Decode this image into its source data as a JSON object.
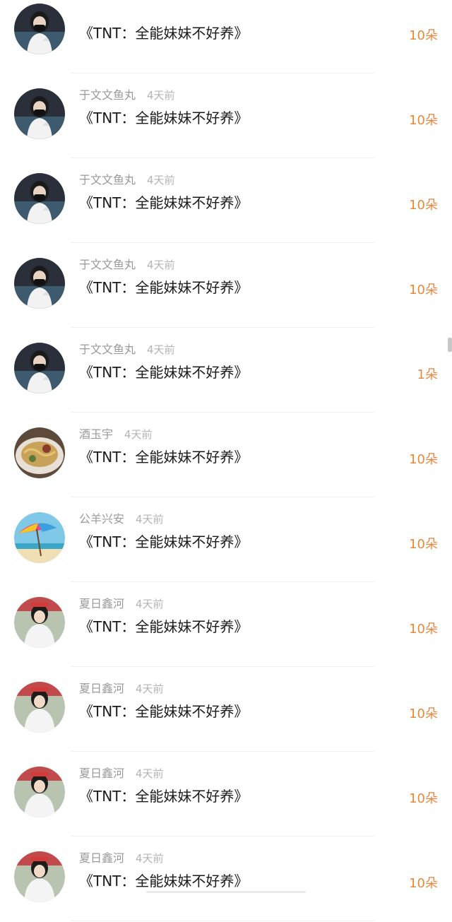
{
  "items": [
    {
      "username": "",
      "time": "",
      "title": "《TNT：全能妹妹不好养》",
      "amount": "10朵",
      "avatar": "girl-mask-icon"
    },
    {
      "username": "于文文鱼丸",
      "time": "4天前",
      "title": "《TNT：全能妹妹不好养》",
      "amount": "10朵",
      "avatar": "girl-mask-icon"
    },
    {
      "username": "于文文鱼丸",
      "time": "4天前",
      "title": "《TNT：全能妹妹不好养》",
      "amount": "10朵",
      "avatar": "girl-mask-icon"
    },
    {
      "username": "于文文鱼丸",
      "time": "4天前",
      "title": "《TNT：全能妹妹不好养》",
      "amount": "10朵",
      "avatar": "girl-mask-icon"
    },
    {
      "username": "于文文鱼丸",
      "time": "4天前",
      "title": "《TNT：全能妹妹不好养》",
      "amount": "1朵",
      "avatar": "girl-mask-icon"
    },
    {
      "username": "酒玉宇",
      "time": "4天前",
      "title": "《TNT：全能妹妹不好养》",
      "amount": "10朵",
      "avatar": "noodle-bowl-icon"
    },
    {
      "username": "公羊兴安",
      "time": "4天前",
      "title": "《TNT：全能妹妹不好养》",
      "amount": "10朵",
      "avatar": "beach-umbrella-icon"
    },
    {
      "username": "夏日鑫河",
      "time": "4天前",
      "title": "《TNT：全能妹妹不好养》",
      "amount": "10朵",
      "avatar": "costume-girl-icon"
    },
    {
      "username": "夏日鑫河",
      "time": "4天前",
      "title": "《TNT：全能妹妹不好养》",
      "amount": "10朵",
      "avatar": "costume-girl-icon"
    },
    {
      "username": "夏日鑫河",
      "time": "4天前",
      "title": "《TNT：全能妹妹不好养》",
      "amount": "10朵",
      "avatar": "costume-girl-icon"
    },
    {
      "username": "夏日鑫河",
      "time": "4天前",
      "title": "《TNT：全能妹妹不好养》",
      "amount": "10朵",
      "avatar": "costume-girl-icon"
    }
  ],
  "colors": {
    "amount": "#e8873e",
    "username": "#9a9a9a",
    "title": "#1a1a1a"
  }
}
